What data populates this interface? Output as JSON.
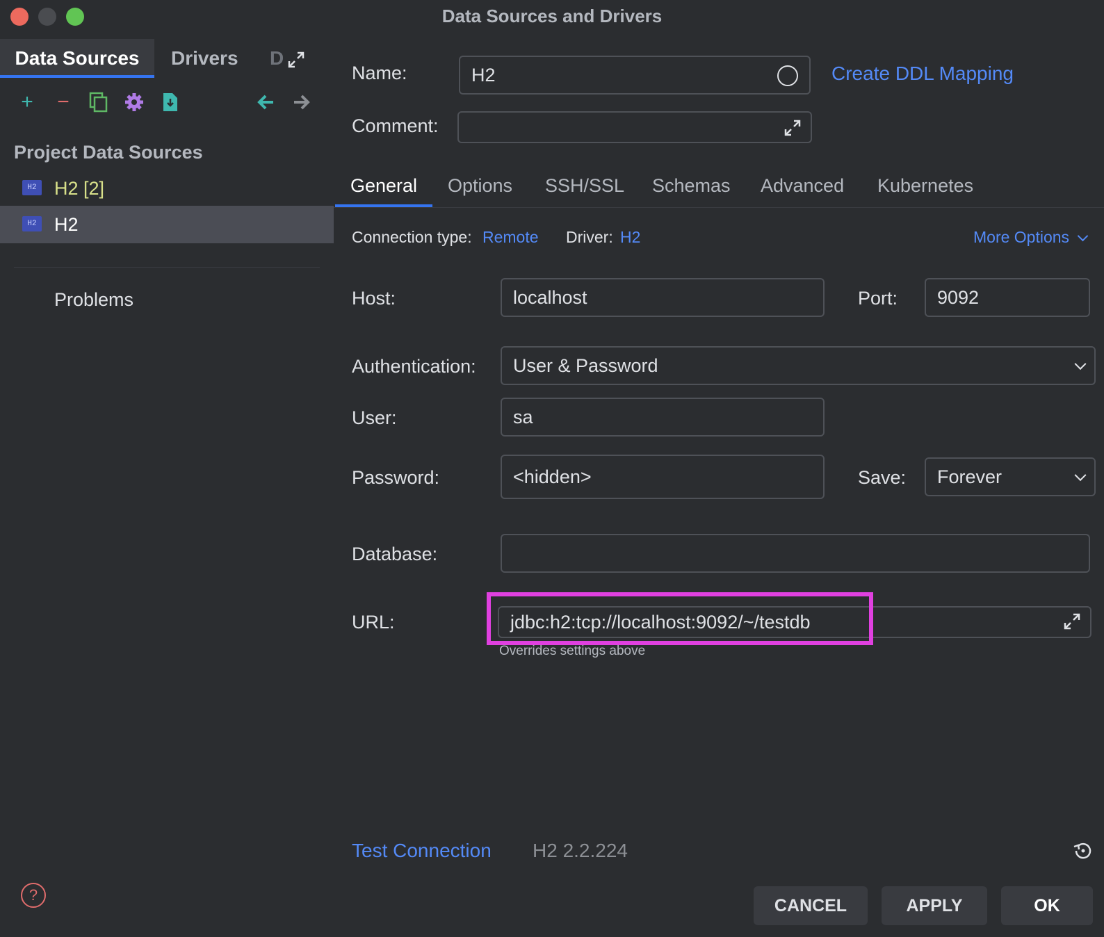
{
  "window": {
    "title": "Data Sources and Drivers"
  },
  "left": {
    "tabs": {
      "data_sources": "Data Sources",
      "drivers": "Drivers",
      "truncated": "D"
    },
    "section_title": "Project Data Sources",
    "items": [
      {
        "label": "H2 [2]",
        "icon": "H2"
      },
      {
        "label": "H2",
        "icon": "H2"
      }
    ],
    "problems": "Problems"
  },
  "form": {
    "name_label": "Name:",
    "name_value": "H2",
    "create_ddl": "Create DDL Mapping",
    "comment_label": "Comment:",
    "comment_value": ""
  },
  "tabs": [
    "General",
    "Options",
    "SSH/SSL",
    "Schemas",
    "Advanced",
    "Kubernetes"
  ],
  "general": {
    "connection_type_label": "Connection type:",
    "connection_type_value": "Remote",
    "driver_label": "Driver:",
    "driver_value": "H2",
    "more_options": "More Options",
    "host_label": "Host:",
    "host_value": "localhost",
    "port_label": "Port:",
    "port_value": "9092",
    "auth_label": "Authentication:",
    "auth_value": "User & Password",
    "user_label": "User:",
    "user_value": "sa",
    "password_label": "Password:",
    "password_value": "<hidden>",
    "save_label": "Save:",
    "save_value": "Forever",
    "database_label": "Database:",
    "database_value": "",
    "url_label": "URL:",
    "url_value": "jdbc:h2:tcp://localhost:9092/~/testdb",
    "url_hint": "Overrides settings above"
  },
  "footer": {
    "test_connection": "Test Connection",
    "driver_version": "H2 2.2.224",
    "cancel": "CANCEL",
    "apply": "APPLY",
    "ok": "OK"
  },
  "colors": {
    "accent": "#3574f0",
    "link": "#548af7",
    "highlight": "#e040e0"
  }
}
